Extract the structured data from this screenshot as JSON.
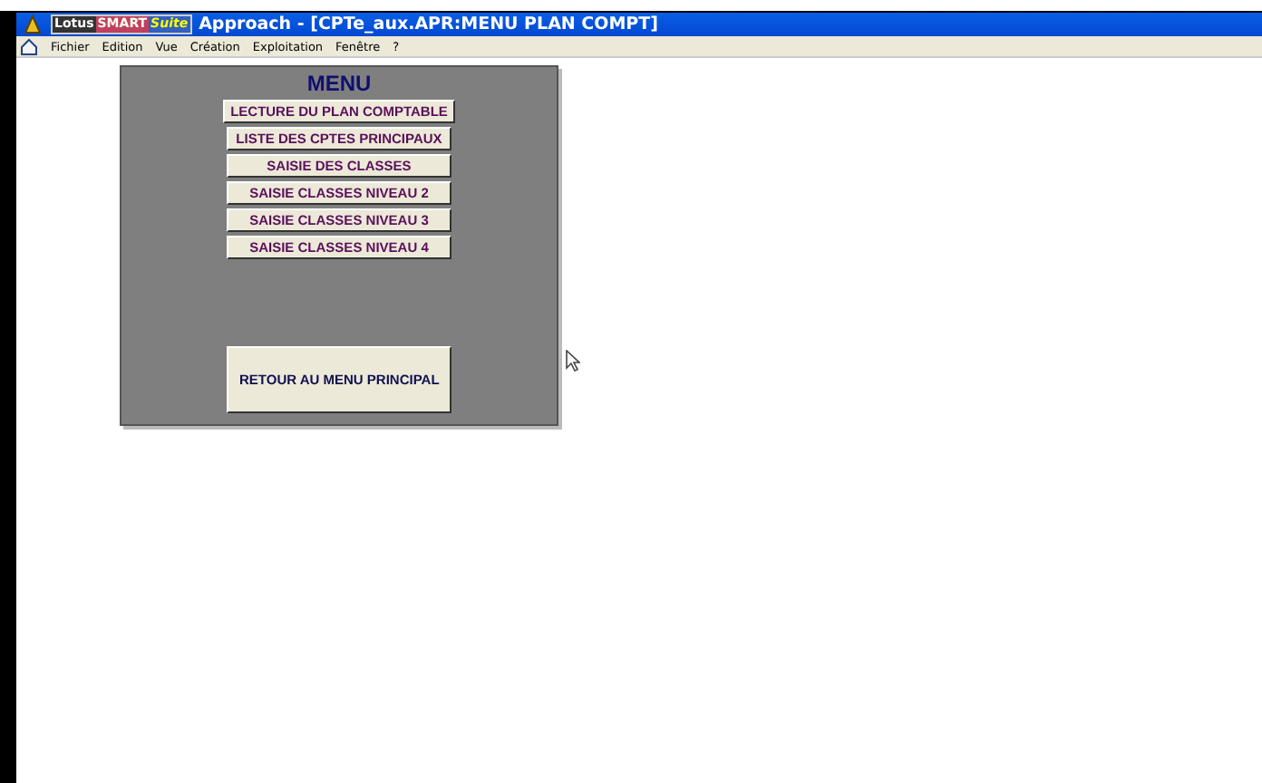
{
  "window": {
    "logo": [
      "Lotus",
      "SMART",
      "Suite"
    ],
    "title": "Approach - [CPTe_aux.APR:MENU PLAN COMPT]"
  },
  "menu_bar": [
    "Fichier",
    "Edition",
    "Vue",
    "Création",
    "Exploitation",
    "Fenêtre",
    "?"
  ],
  "panel": {
    "title": "MENU",
    "buttons": [
      {
        "label": "LECTURE DU PLAN COMPTABLE"
      },
      {
        "label": "LISTE DES CPTES PRINCIPAUX"
      },
      {
        "label": "SAISIE DES CLASSES"
      },
      {
        "label": "SAISIE CLASSES NIVEAU 2"
      },
      {
        "label": "SAISIE CLASSES NIVEAU 3"
      },
      {
        "label": "SAISIE CLASSES NIVEAU 4"
      }
    ],
    "return_button": "RETOUR AU MENU PRINCIPAL"
  }
}
